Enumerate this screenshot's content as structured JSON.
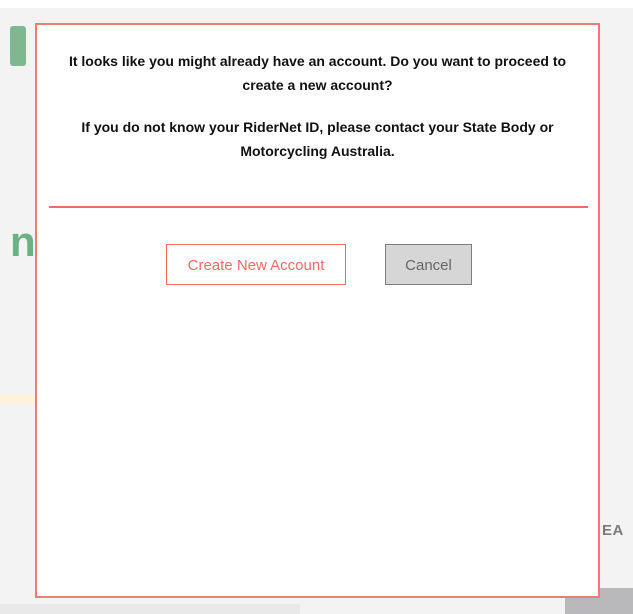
{
  "background": {
    "partial_letter": "n",
    "partial_text": "EA"
  },
  "dialog": {
    "message_line1": "It looks like you might already have an account. Do you want to proceed to create a new account?",
    "message_line2": "If you do not know your RiderNet ID, please contact your State Body or Motorcycling Australia.",
    "buttons": {
      "create_label": "Create New Account",
      "cancel_label": "Cancel"
    }
  },
  "colors": {
    "accent": "#ea6e66",
    "modal_border": "#ee7c73",
    "cancel_background": "#d6d6d6",
    "background_green": "#6ab183"
  }
}
